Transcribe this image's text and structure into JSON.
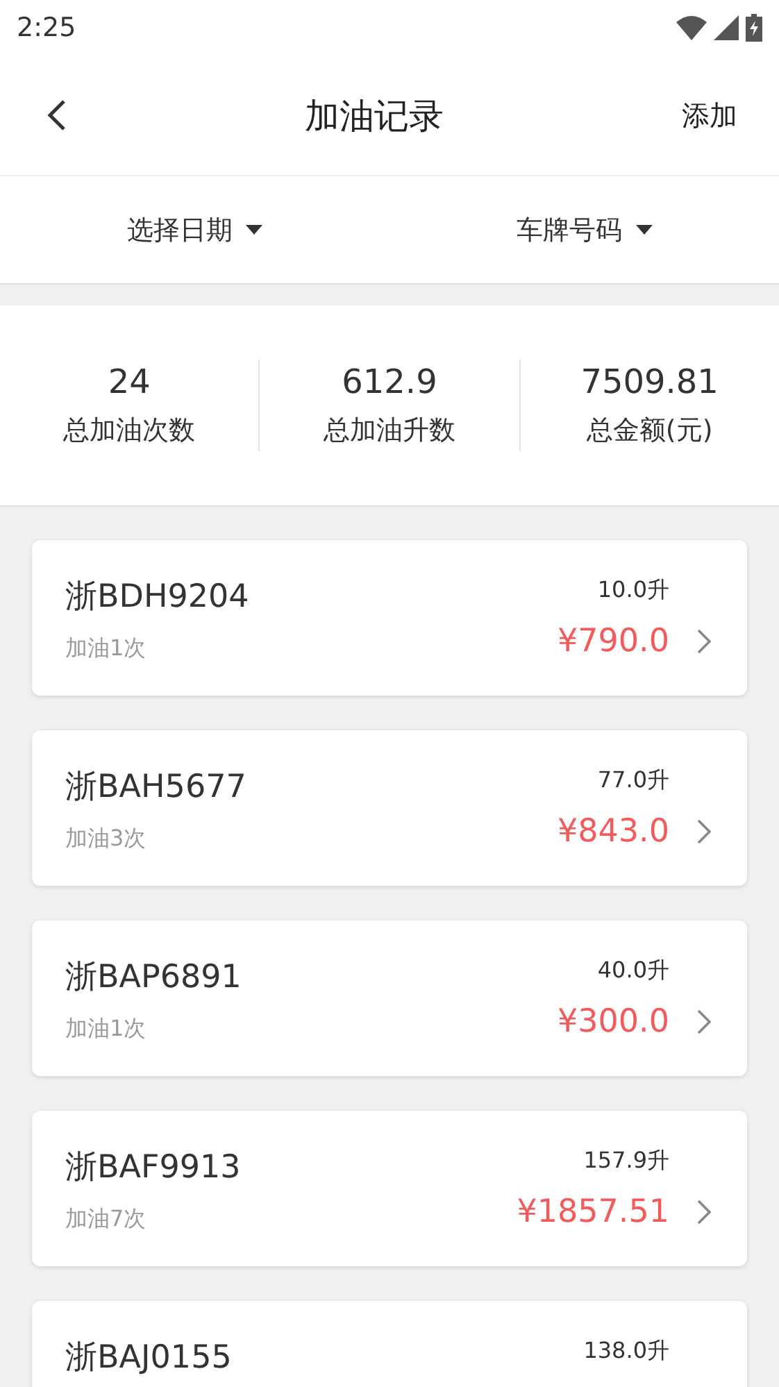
{
  "status_bar": {
    "time": "2:25"
  },
  "header": {
    "title": "加油记录",
    "action": "添加"
  },
  "filters": [
    {
      "label": "选择日期"
    },
    {
      "label": "车牌号码"
    }
  ],
  "stats": [
    {
      "value": "24",
      "label": "总加油次数"
    },
    {
      "value": "612.9",
      "label": "总加油升数"
    },
    {
      "value": "7509.81",
      "label": "总金额(元)"
    }
  ],
  "records": [
    {
      "plate": "浙BDH9204",
      "count": "加油1次",
      "liters": "10.0升",
      "amount": "¥790.0"
    },
    {
      "plate": "浙BAH5677",
      "count": "加油3次",
      "liters": "77.0升",
      "amount": "¥843.0"
    },
    {
      "plate": "浙BAP6891",
      "count": "加油1次",
      "liters": "40.0升",
      "amount": "¥300.0"
    },
    {
      "plate": "浙BAF9913",
      "count": "加油7次",
      "liters": "157.9升",
      "amount": "¥1857.51"
    },
    {
      "plate": "浙BAJ0155",
      "liters": "138.0升"
    }
  ]
}
